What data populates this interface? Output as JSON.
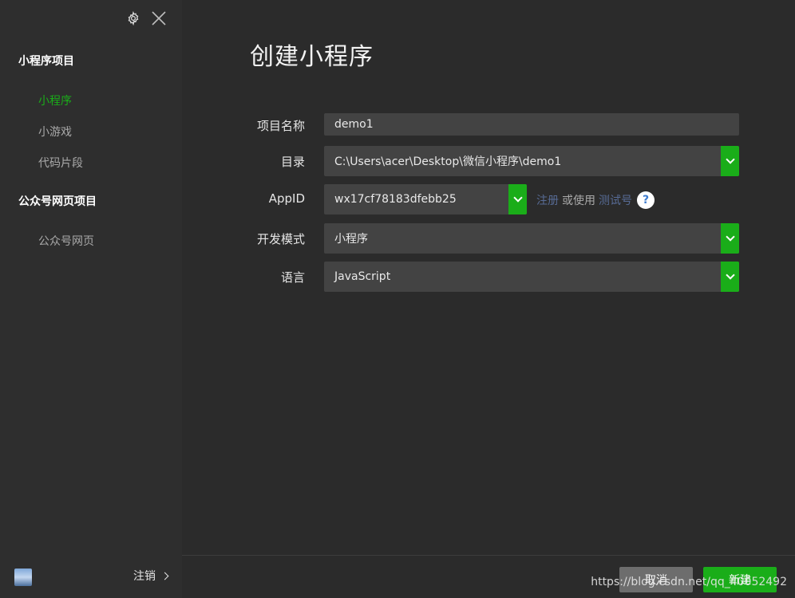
{
  "window": {
    "title": "创建小程序"
  },
  "sidebar": {
    "sections": [
      {
        "title": "小程序项目",
        "items": [
          {
            "label": "小程序",
            "active": true
          },
          {
            "label": "小游戏",
            "active": false
          },
          {
            "label": "代码片段",
            "active": false
          }
        ]
      },
      {
        "title": "公众号网页项目",
        "items": [
          {
            "label": "公众号网页",
            "active": false
          }
        ]
      }
    ],
    "logout_label": "注销",
    "icons": [
      "gear-icon",
      "close-icon",
      "avatar",
      "chevron-right-icon"
    ]
  },
  "form": {
    "project_name": {
      "label": "项目名称",
      "value": "demo1"
    },
    "directory": {
      "label": "目录",
      "value": "C:\\Users\\acer\\Desktop\\微信小程序\\demo1"
    },
    "appid": {
      "label": "AppID",
      "value": "wx17cf78183dfebb25",
      "register_link": "注册",
      "or_use_text": "或使用",
      "test_account_link": "测试号",
      "help": "?"
    },
    "dev_mode": {
      "label": "开发模式",
      "value": "小程序"
    },
    "language": {
      "label": "语言",
      "value": "JavaScript"
    }
  },
  "footer": {
    "cancel_label": "取消",
    "create_label": "新建",
    "watermark": "https://blog.csdn.net/qq_40052492"
  },
  "colors": {
    "accent": "#1aad19",
    "link": "#576b95",
    "background": "#2b2b2b",
    "sidebar": "#2e2e2e",
    "field": "#434343"
  }
}
